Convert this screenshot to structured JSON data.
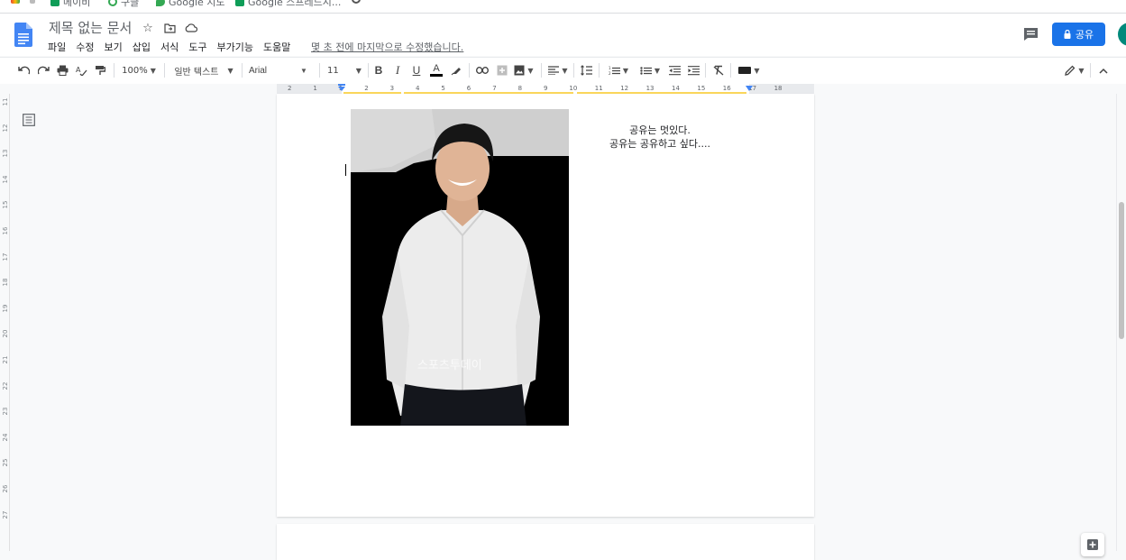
{
  "bookmarks": [
    {
      "label": "메이비",
      "icon": "sheets-icon"
    },
    {
      "label": "구글",
      "icon": "google-icon"
    },
    {
      "label": "Google 지도",
      "icon": "maps-icon"
    },
    {
      "label": "Google 스프레드시...",
      "icon": "sheets-icon"
    }
  ],
  "document": {
    "title": "제목 없는 문서",
    "last_edit": "몇 초 전에 마지막으로 수정했습니다."
  },
  "menus": [
    "파일",
    "수정",
    "보기",
    "삽입",
    "서식",
    "도구",
    "부가기능",
    "도움말"
  ],
  "share": {
    "label": "공유"
  },
  "toolbar": {
    "zoom": "100%",
    "style": "일반 텍스트",
    "font": "Arial",
    "font_size": "11",
    "bold": "B",
    "italic": "I",
    "underline": "U",
    "text_color": "A"
  },
  "ruler": {
    "numbers": [
      "2",
      "1",
      "1",
      "2",
      "3",
      "4",
      "5",
      "6",
      "7",
      "8",
      "9",
      "10",
      "11",
      "12",
      "13",
      "14",
      "15",
      "16",
      "17",
      "18"
    ],
    "vertical_numbers": [
      "11",
      "12",
      "13",
      "14",
      "15",
      "16",
      "17",
      "18",
      "19",
      "20",
      "21",
      "22",
      "23",
      "24",
      "25",
      "26",
      "27"
    ]
  },
  "content": {
    "caption_line1": "공유는 멋있다.",
    "caption_line2": "공유는 공유하고 싶다....",
    "photo_watermark": "스포츠투데이"
  },
  "colors": {
    "accent": "#1a73e8",
    "doc_blue": "#4285f4",
    "avatar": "#00897b"
  }
}
